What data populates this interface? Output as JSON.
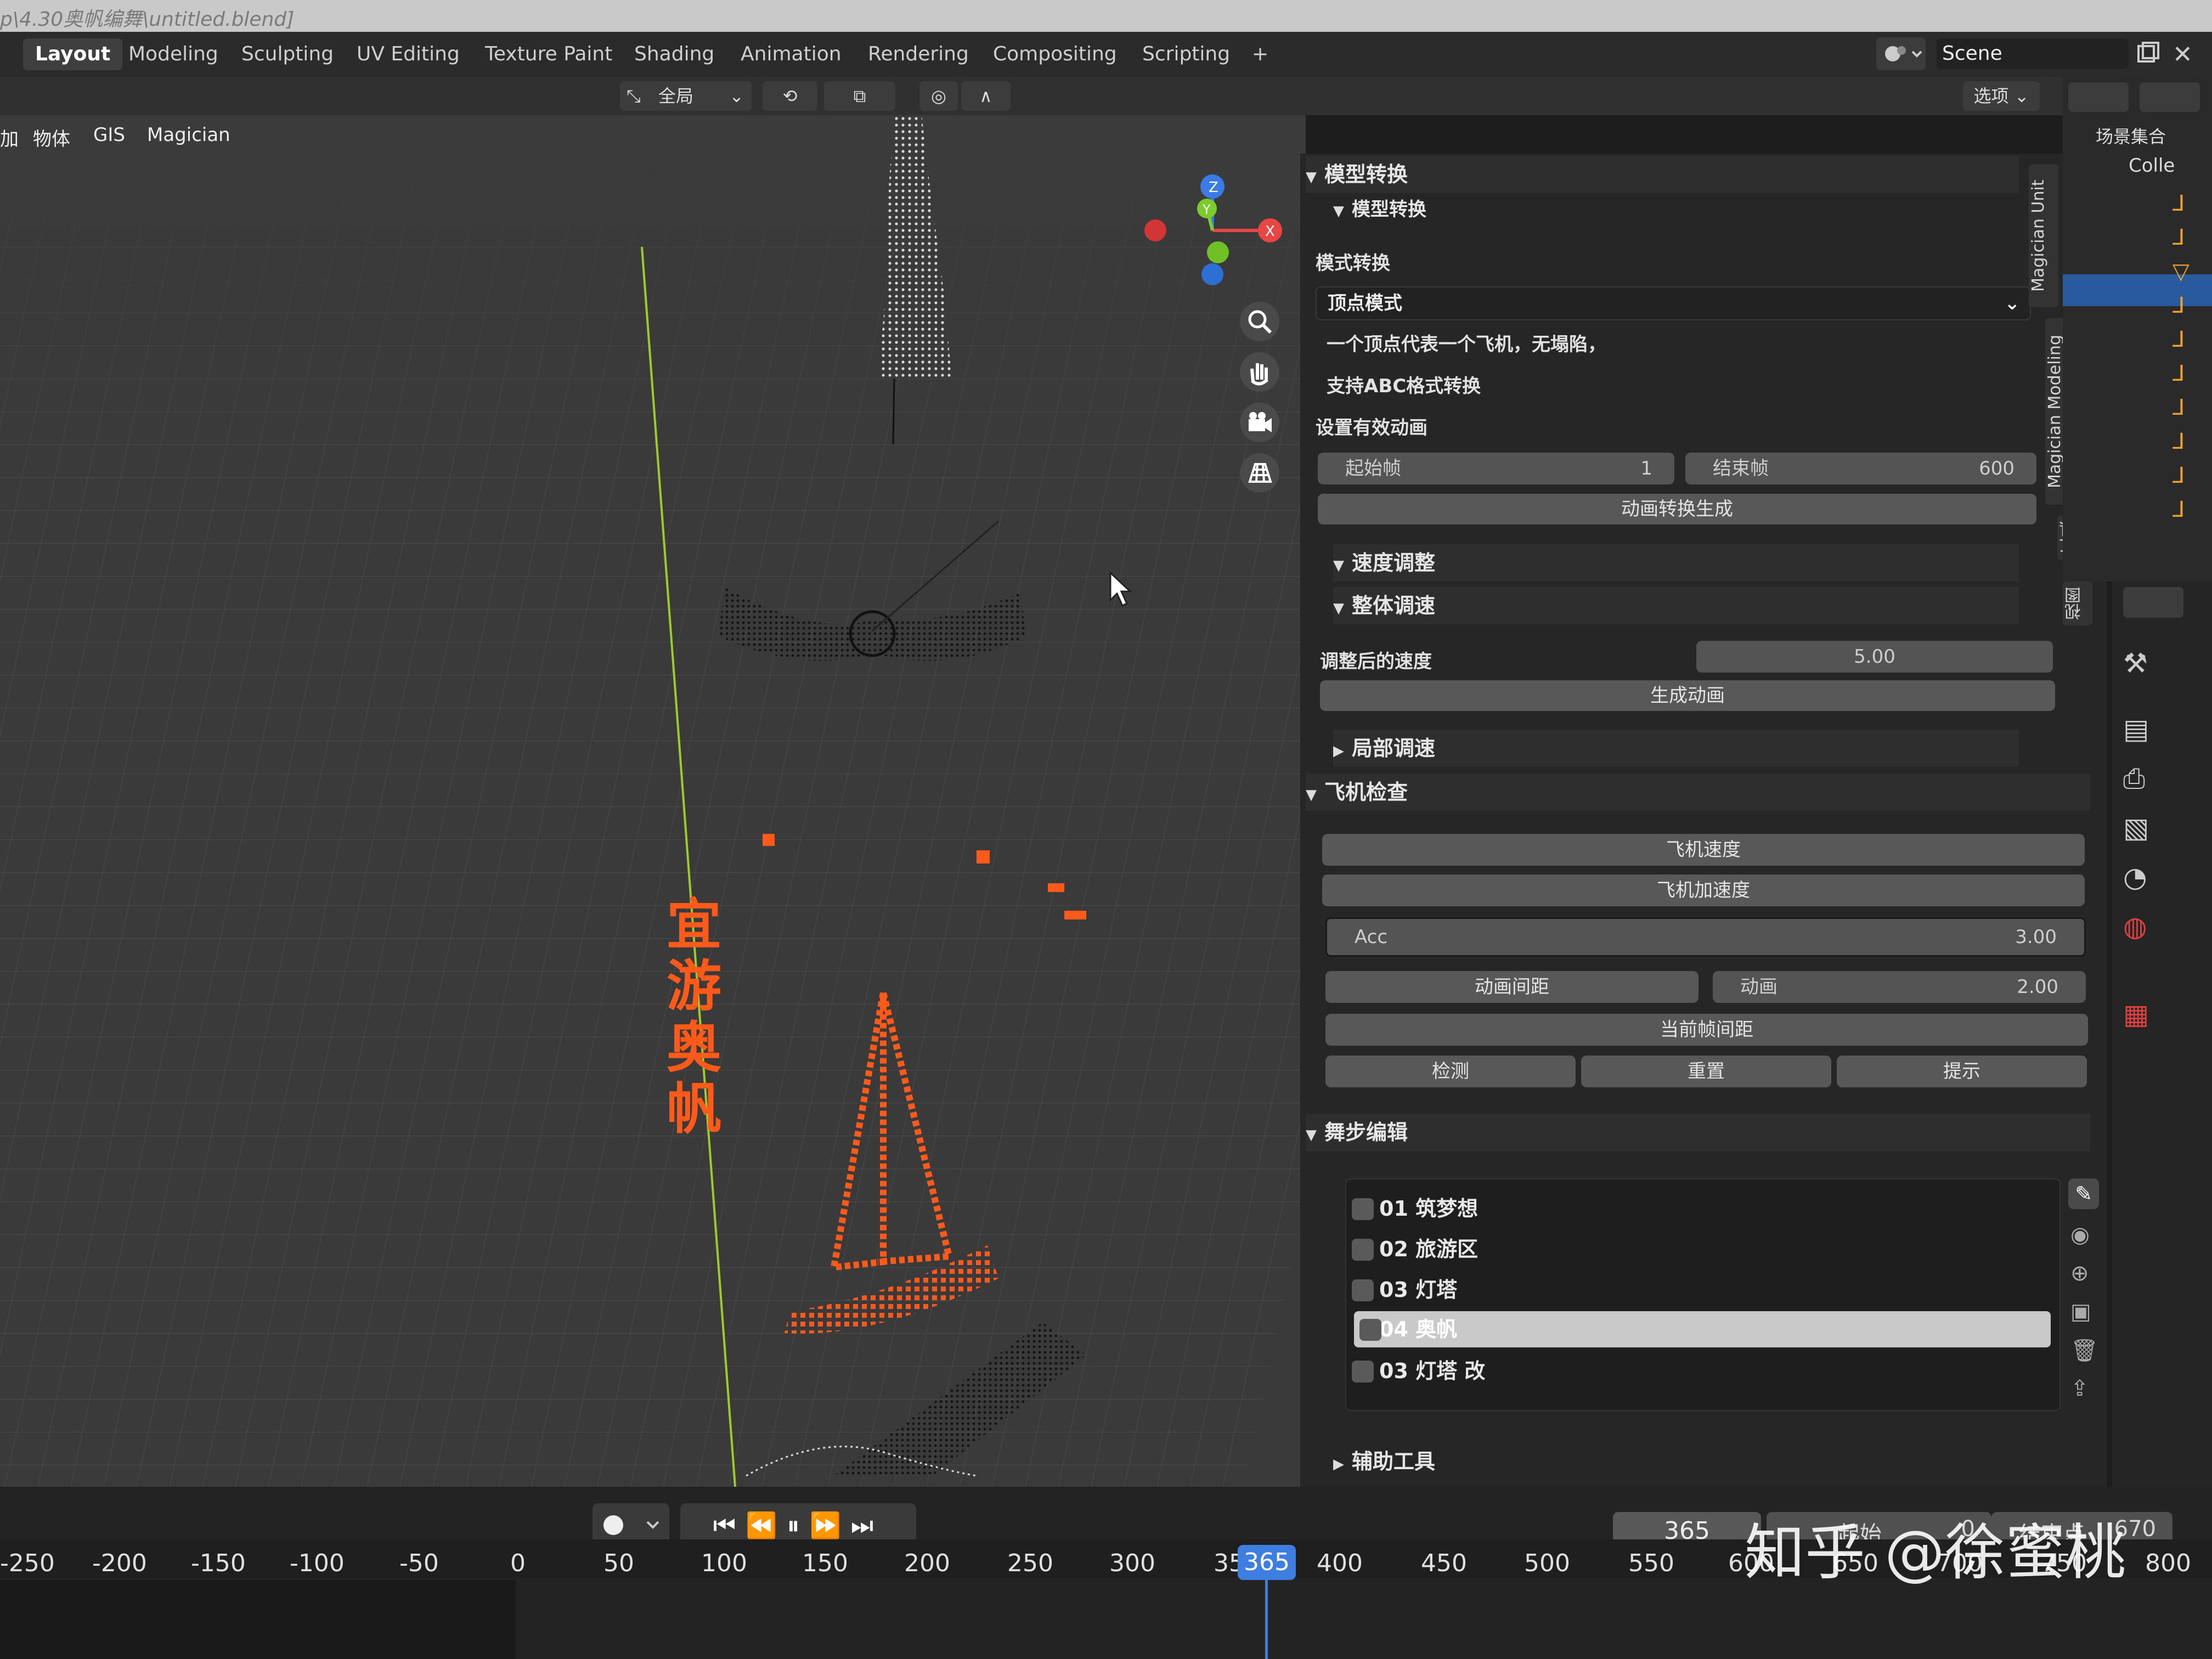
{
  "window": {
    "title": "p\\4.30奥帆编舞\\untitled.blend]"
  },
  "workspaces": [
    "Layout",
    "Modeling",
    "Sculpting",
    "UV Editing",
    "Texture Paint",
    "Shading",
    "Animation",
    "Rendering",
    "Compositing",
    "Scripting",
    "+"
  ],
  "active_workspace": "Layout",
  "scene": {
    "label": "Scene"
  },
  "header": {
    "transform_orientation": "全局",
    "options_label": "选项"
  },
  "viewport": {
    "menus": [
      "加",
      "物体",
      "GIS",
      "Magician"
    ],
    "text_on_object": "宜游奥帆",
    "gizmo": {
      "x": "X",
      "y": "Y",
      "z": "Z"
    }
  },
  "panel": {
    "model_convert": {
      "title": "模型转换",
      "subtitle": "模型转换",
      "mode_label": "模式转换",
      "mode_value": "顶点模式",
      "desc1": "一个顶点代表一个飞机，无塌陷，",
      "desc2": "支持ABC格式转换",
      "anim_label": "设置有效动画",
      "start_label": "起始帧",
      "start_value": "1",
      "end_label": "结束帧",
      "end_value": "600",
      "gen_button": "动画转换生成"
    },
    "speed": {
      "title": "速度调整",
      "overall_title": "整体调速",
      "adjusted_label": "调整后的速度",
      "adjusted_value": "5.00",
      "gen_button": "生成动画",
      "local_title": "局部调速"
    },
    "check": {
      "title": "飞机检查",
      "speed_button": "飞机速度",
      "acc_button": "飞机加速度",
      "acc_label": "Acc",
      "acc_value": "3.00",
      "spacing_button": "动画间距",
      "anim_label": "动画",
      "anim_value": "2.00",
      "current_spacing_button": "当前帧间距",
      "detect_button": "检测",
      "reset_button": "重置",
      "hint_button": "提示"
    },
    "choreo": {
      "title": "舞步编辑",
      "items": [
        "01 筑梦想",
        "02 旅游区",
        "03 灯塔",
        "04 奥帆",
        "03 灯塔 改"
      ],
      "selected_index": 3
    },
    "aux": {
      "title": "辅助工具"
    }
  },
  "side_tabs": [
    "Magician Unit",
    "Magician Modeling",
    "工具",
    "视图"
  ],
  "outliner": {
    "title": "场景集合",
    "collection": "Colle"
  },
  "timeline": {
    "current_frame": "365",
    "start_label": "起始",
    "start_value": "0",
    "end_label": "结束点",
    "end_value": "670",
    "ticks": [
      "-250",
      "-200",
      "-150",
      "-100",
      "-50",
      "0",
      "50",
      "100",
      "150",
      "200",
      "250",
      "300",
      "35",
      "400",
      "450",
      "500",
      "550",
      "600",
      "650",
      "700",
      "750",
      "800"
    ],
    "playhead": "365"
  },
  "watermark": "知乎 @徐蜜桃"
}
